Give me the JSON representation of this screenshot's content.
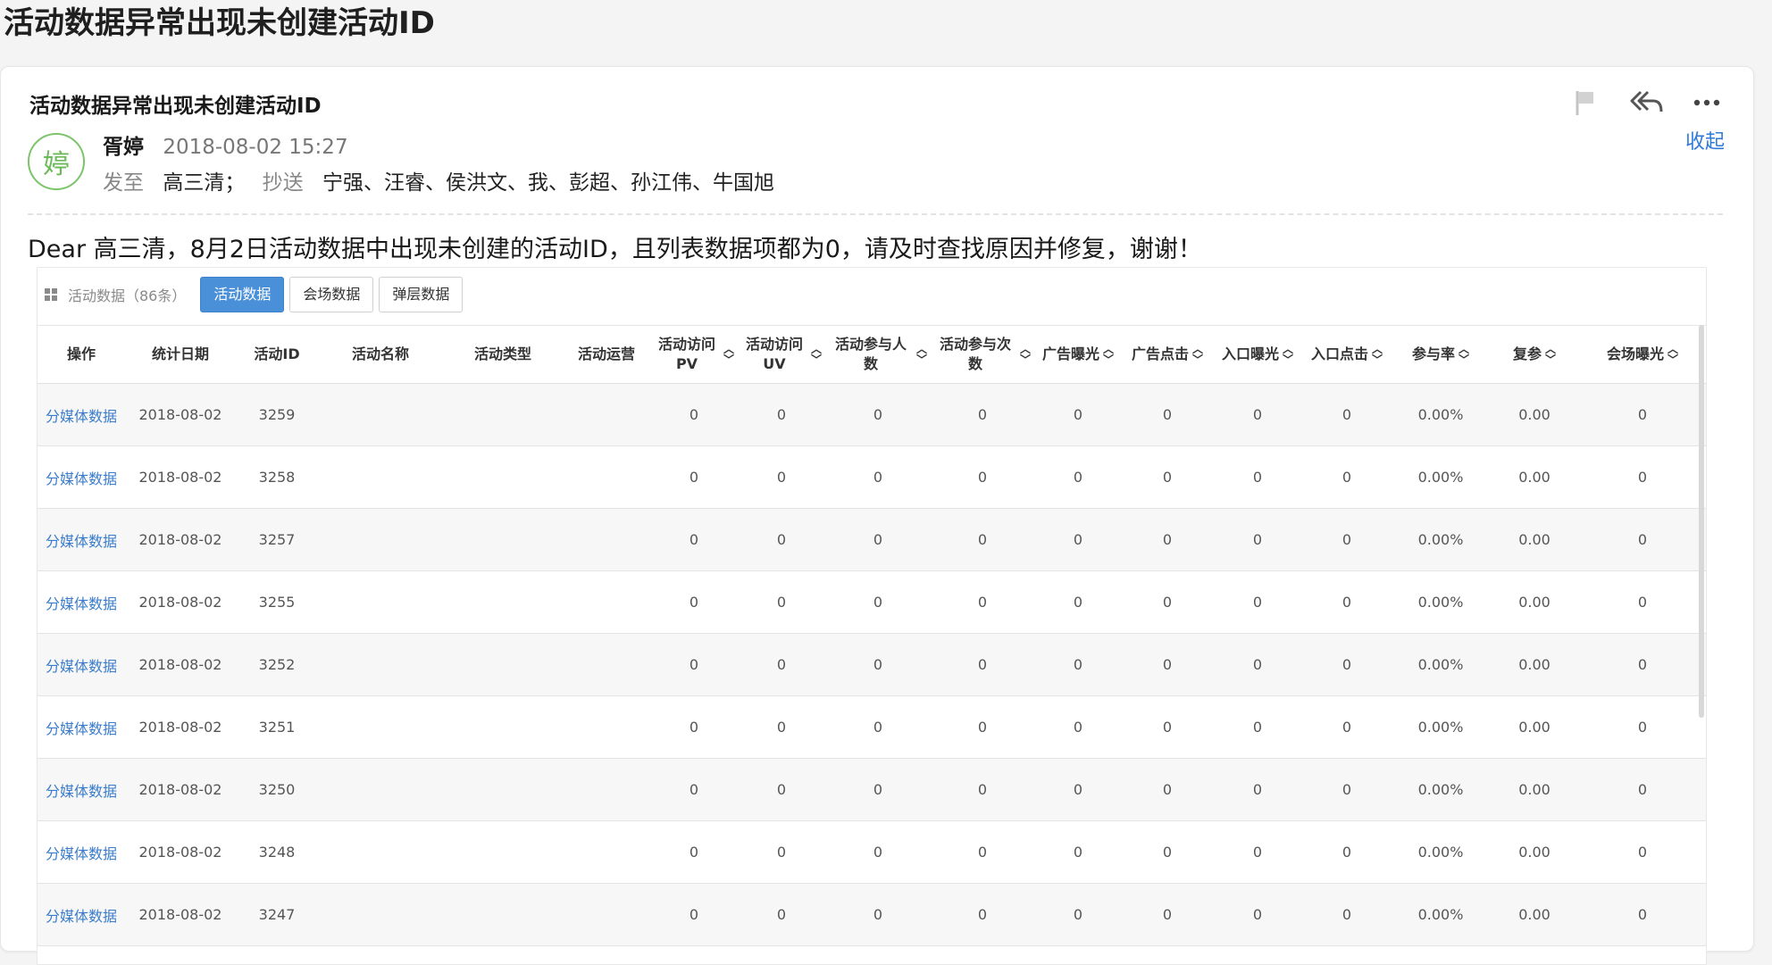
{
  "page_title": "活动数据异常出现未创建活动ID",
  "email": {
    "subject": "活动数据异常出现未创建活动ID",
    "collapse_label": "收起",
    "avatar_char": "婷",
    "sender_name": "胥婷",
    "sent_time": "2018-08-02 15:27",
    "to_label": "发至",
    "to": "高三清；",
    "cc_label": "抄送",
    "cc": "宁强、汪睿、侯洪文、我、彭超、孙江伟、牛国旭",
    "body": "Dear 高三清，8月2日活动数据中出现未创建的活动ID，且列表数据项都为0，请及时查找原因并修复，谢谢！"
  },
  "toolbar_icons": [
    "flag-icon",
    "reply-all-icon",
    "more-icon"
  ],
  "table": {
    "caption": "活动数据（86条）",
    "tabs": [
      "活动数据",
      "会场数据",
      "弹层数据"
    ],
    "active_tab": 0,
    "columns": [
      "操作",
      "统计日期",
      "活动ID",
      "活动名称",
      "活动类型",
      "活动运营",
      "活动访问PV",
      "活动访问UV",
      "活动参与人数",
      "活动参与次数",
      "广告曝光",
      "广告点击",
      "入口曝光",
      "入口点击",
      "参与率",
      "复参",
      "会场曝光"
    ],
    "rows": [
      {
        "op": "分媒体数据",
        "date": "2018-08-02",
        "id": "3259",
        "name": "",
        "type": "",
        "operator": "",
        "pv": "0",
        "uv": "0",
        "people": "0",
        "times": "0",
        "ad_exp": "0",
        "ad_click": "0",
        "entry_exp": "0",
        "entry_click": "0",
        "rate": "0.00%",
        "repeat": "0.00",
        "venue_exp": "0"
      },
      {
        "op": "分媒体数据",
        "date": "2018-08-02",
        "id": "3258",
        "name": "",
        "type": "",
        "operator": "",
        "pv": "0",
        "uv": "0",
        "people": "0",
        "times": "0",
        "ad_exp": "0",
        "ad_click": "0",
        "entry_exp": "0",
        "entry_click": "0",
        "rate": "0.00%",
        "repeat": "0.00",
        "venue_exp": "0"
      },
      {
        "op": "分媒体数据",
        "date": "2018-08-02",
        "id": "3257",
        "name": "",
        "type": "",
        "operator": "",
        "pv": "0",
        "uv": "0",
        "people": "0",
        "times": "0",
        "ad_exp": "0",
        "ad_click": "0",
        "entry_exp": "0",
        "entry_click": "0",
        "rate": "0.00%",
        "repeat": "0.00",
        "venue_exp": "0"
      },
      {
        "op": "分媒体数据",
        "date": "2018-08-02",
        "id": "3255",
        "name": "",
        "type": "",
        "operator": "",
        "pv": "0",
        "uv": "0",
        "people": "0",
        "times": "0",
        "ad_exp": "0",
        "ad_click": "0",
        "entry_exp": "0",
        "entry_click": "0",
        "rate": "0.00%",
        "repeat": "0.00",
        "venue_exp": "0"
      },
      {
        "op": "分媒体数据",
        "date": "2018-08-02",
        "id": "3252",
        "name": "",
        "type": "",
        "operator": "",
        "pv": "0",
        "uv": "0",
        "people": "0",
        "times": "0",
        "ad_exp": "0",
        "ad_click": "0",
        "entry_exp": "0",
        "entry_click": "0",
        "rate": "0.00%",
        "repeat": "0.00",
        "venue_exp": "0"
      },
      {
        "op": "分媒体数据",
        "date": "2018-08-02",
        "id": "3251",
        "name": "",
        "type": "",
        "operator": "",
        "pv": "0",
        "uv": "0",
        "people": "0",
        "times": "0",
        "ad_exp": "0",
        "ad_click": "0",
        "entry_exp": "0",
        "entry_click": "0",
        "rate": "0.00%",
        "repeat": "0.00",
        "venue_exp": "0"
      },
      {
        "op": "分媒体数据",
        "date": "2018-08-02",
        "id": "3250",
        "name": "",
        "type": "",
        "operator": "",
        "pv": "0",
        "uv": "0",
        "people": "0",
        "times": "0",
        "ad_exp": "0",
        "ad_click": "0",
        "entry_exp": "0",
        "entry_click": "0",
        "rate": "0.00%",
        "repeat": "0.00",
        "venue_exp": "0"
      },
      {
        "op": "分媒体数据",
        "date": "2018-08-02",
        "id": "3248",
        "name": "",
        "type": "",
        "operator": "",
        "pv": "0",
        "uv": "0",
        "people": "0",
        "times": "0",
        "ad_exp": "0",
        "ad_click": "0",
        "entry_exp": "0",
        "entry_click": "0",
        "rate": "0.00%",
        "repeat": "0.00",
        "venue_exp": "0"
      },
      {
        "op": "分媒体数据",
        "date": "2018-08-02",
        "id": "3247",
        "name": "",
        "type": "",
        "operator": "",
        "pv": "0",
        "uv": "0",
        "people": "0",
        "times": "0",
        "ad_exp": "0",
        "ad_click": "0",
        "entry_exp": "0",
        "entry_click": "0",
        "rate": "0.00%",
        "repeat": "0.00",
        "venue_exp": "0"
      }
    ]
  },
  "colors": {
    "accent": "#4a90d9",
    "link": "#3a7ccc",
    "avatar": "#6cb95a"
  }
}
